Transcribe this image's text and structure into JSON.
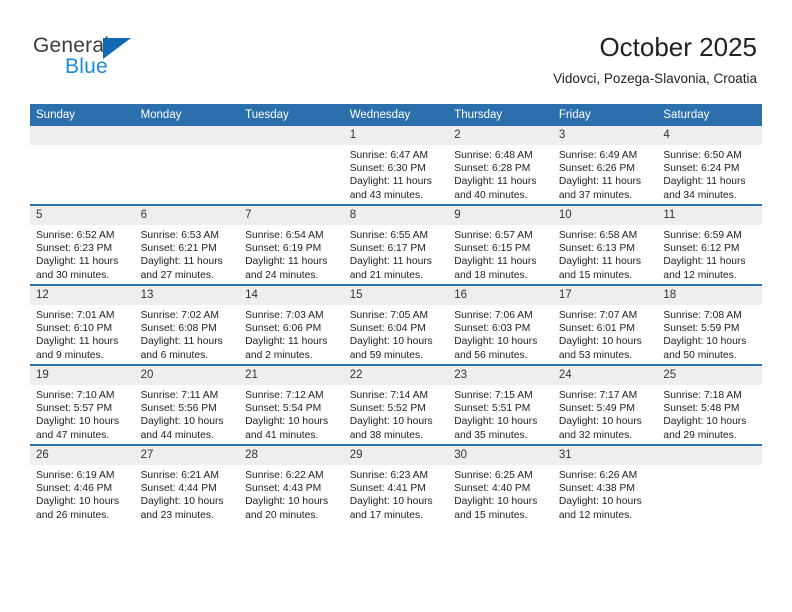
{
  "brand": {
    "name_part1": "General",
    "name_part2": "Blue",
    "accent_color": "#1268b3",
    "blue_text_color": "#1a8cd8"
  },
  "header": {
    "title": "October 2025",
    "subtitle": "Vidovci, Pozega-Slavonia, Croatia"
  },
  "colors": {
    "header_row_bg": "#2c6fad",
    "day_band_bg": "#eeeeee",
    "row_divider": "#2c6fad"
  },
  "weekdays": [
    "Sunday",
    "Monday",
    "Tuesday",
    "Wednesday",
    "Thursday",
    "Friday",
    "Saturday"
  ],
  "weeks": [
    [
      {
        "day": "",
        "sunrise": "",
        "sunset": "",
        "daylight_line1": "",
        "daylight_line2": ""
      },
      {
        "day": "",
        "sunrise": "",
        "sunset": "",
        "daylight_line1": "",
        "daylight_line2": ""
      },
      {
        "day": "",
        "sunrise": "",
        "sunset": "",
        "daylight_line1": "",
        "daylight_line2": ""
      },
      {
        "day": "1",
        "sunrise": "Sunrise: 6:47 AM",
        "sunset": "Sunset: 6:30 PM",
        "daylight_line1": "Daylight: 11 hours",
        "daylight_line2": "and 43 minutes."
      },
      {
        "day": "2",
        "sunrise": "Sunrise: 6:48 AM",
        "sunset": "Sunset: 6:28 PM",
        "daylight_line1": "Daylight: 11 hours",
        "daylight_line2": "and 40 minutes."
      },
      {
        "day": "3",
        "sunrise": "Sunrise: 6:49 AM",
        "sunset": "Sunset: 6:26 PM",
        "daylight_line1": "Daylight: 11 hours",
        "daylight_line2": "and 37 minutes."
      },
      {
        "day": "4",
        "sunrise": "Sunrise: 6:50 AM",
        "sunset": "Sunset: 6:24 PM",
        "daylight_line1": "Daylight: 11 hours",
        "daylight_line2": "and 34 minutes."
      }
    ],
    [
      {
        "day": "5",
        "sunrise": "Sunrise: 6:52 AM",
        "sunset": "Sunset: 6:23 PM",
        "daylight_line1": "Daylight: 11 hours",
        "daylight_line2": "and 30 minutes."
      },
      {
        "day": "6",
        "sunrise": "Sunrise: 6:53 AM",
        "sunset": "Sunset: 6:21 PM",
        "daylight_line1": "Daylight: 11 hours",
        "daylight_line2": "and 27 minutes."
      },
      {
        "day": "7",
        "sunrise": "Sunrise: 6:54 AM",
        "sunset": "Sunset: 6:19 PM",
        "daylight_line1": "Daylight: 11 hours",
        "daylight_line2": "and 24 minutes."
      },
      {
        "day": "8",
        "sunrise": "Sunrise: 6:55 AM",
        "sunset": "Sunset: 6:17 PM",
        "daylight_line1": "Daylight: 11 hours",
        "daylight_line2": "and 21 minutes."
      },
      {
        "day": "9",
        "sunrise": "Sunrise: 6:57 AM",
        "sunset": "Sunset: 6:15 PM",
        "daylight_line1": "Daylight: 11 hours",
        "daylight_line2": "and 18 minutes."
      },
      {
        "day": "10",
        "sunrise": "Sunrise: 6:58 AM",
        "sunset": "Sunset: 6:13 PM",
        "daylight_line1": "Daylight: 11 hours",
        "daylight_line2": "and 15 minutes."
      },
      {
        "day": "11",
        "sunrise": "Sunrise: 6:59 AM",
        "sunset": "Sunset: 6:12 PM",
        "daylight_line1": "Daylight: 11 hours",
        "daylight_line2": "and 12 minutes."
      }
    ],
    [
      {
        "day": "12",
        "sunrise": "Sunrise: 7:01 AM",
        "sunset": "Sunset: 6:10 PM",
        "daylight_line1": "Daylight: 11 hours",
        "daylight_line2": "and 9 minutes."
      },
      {
        "day": "13",
        "sunrise": "Sunrise: 7:02 AM",
        "sunset": "Sunset: 6:08 PM",
        "daylight_line1": "Daylight: 11 hours",
        "daylight_line2": "and 6 minutes."
      },
      {
        "day": "14",
        "sunrise": "Sunrise: 7:03 AM",
        "sunset": "Sunset: 6:06 PM",
        "daylight_line1": "Daylight: 11 hours",
        "daylight_line2": "and 2 minutes."
      },
      {
        "day": "15",
        "sunrise": "Sunrise: 7:05 AM",
        "sunset": "Sunset: 6:04 PM",
        "daylight_line1": "Daylight: 10 hours",
        "daylight_line2": "and 59 minutes."
      },
      {
        "day": "16",
        "sunrise": "Sunrise: 7:06 AM",
        "sunset": "Sunset: 6:03 PM",
        "daylight_line1": "Daylight: 10 hours",
        "daylight_line2": "and 56 minutes."
      },
      {
        "day": "17",
        "sunrise": "Sunrise: 7:07 AM",
        "sunset": "Sunset: 6:01 PM",
        "daylight_line1": "Daylight: 10 hours",
        "daylight_line2": "and 53 minutes."
      },
      {
        "day": "18",
        "sunrise": "Sunrise: 7:08 AM",
        "sunset": "Sunset: 5:59 PM",
        "daylight_line1": "Daylight: 10 hours",
        "daylight_line2": "and 50 minutes."
      }
    ],
    [
      {
        "day": "19",
        "sunrise": "Sunrise: 7:10 AM",
        "sunset": "Sunset: 5:57 PM",
        "daylight_line1": "Daylight: 10 hours",
        "daylight_line2": "and 47 minutes."
      },
      {
        "day": "20",
        "sunrise": "Sunrise: 7:11 AM",
        "sunset": "Sunset: 5:56 PM",
        "daylight_line1": "Daylight: 10 hours",
        "daylight_line2": "and 44 minutes."
      },
      {
        "day": "21",
        "sunrise": "Sunrise: 7:12 AM",
        "sunset": "Sunset: 5:54 PM",
        "daylight_line1": "Daylight: 10 hours",
        "daylight_line2": "and 41 minutes."
      },
      {
        "day": "22",
        "sunrise": "Sunrise: 7:14 AM",
        "sunset": "Sunset: 5:52 PM",
        "daylight_line1": "Daylight: 10 hours",
        "daylight_line2": "and 38 minutes."
      },
      {
        "day": "23",
        "sunrise": "Sunrise: 7:15 AM",
        "sunset": "Sunset: 5:51 PM",
        "daylight_line1": "Daylight: 10 hours",
        "daylight_line2": "and 35 minutes."
      },
      {
        "day": "24",
        "sunrise": "Sunrise: 7:17 AM",
        "sunset": "Sunset: 5:49 PM",
        "daylight_line1": "Daylight: 10 hours",
        "daylight_line2": "and 32 minutes."
      },
      {
        "day": "25",
        "sunrise": "Sunrise: 7:18 AM",
        "sunset": "Sunset: 5:48 PM",
        "daylight_line1": "Daylight: 10 hours",
        "daylight_line2": "and 29 minutes."
      }
    ],
    [
      {
        "day": "26",
        "sunrise": "Sunrise: 6:19 AM",
        "sunset": "Sunset: 4:46 PM",
        "daylight_line1": "Daylight: 10 hours",
        "daylight_line2": "and 26 minutes."
      },
      {
        "day": "27",
        "sunrise": "Sunrise: 6:21 AM",
        "sunset": "Sunset: 4:44 PM",
        "daylight_line1": "Daylight: 10 hours",
        "daylight_line2": "and 23 minutes."
      },
      {
        "day": "28",
        "sunrise": "Sunrise: 6:22 AM",
        "sunset": "Sunset: 4:43 PM",
        "daylight_line1": "Daylight: 10 hours",
        "daylight_line2": "and 20 minutes."
      },
      {
        "day": "29",
        "sunrise": "Sunrise: 6:23 AM",
        "sunset": "Sunset: 4:41 PM",
        "daylight_line1": "Daylight: 10 hours",
        "daylight_line2": "and 17 minutes."
      },
      {
        "day": "30",
        "sunrise": "Sunrise: 6:25 AM",
        "sunset": "Sunset: 4:40 PM",
        "daylight_line1": "Daylight: 10 hours",
        "daylight_line2": "and 15 minutes."
      },
      {
        "day": "31",
        "sunrise": "Sunrise: 6:26 AM",
        "sunset": "Sunset: 4:38 PM",
        "daylight_line1": "Daylight: 10 hours",
        "daylight_line2": "and 12 minutes."
      },
      {
        "day": "",
        "sunrise": "",
        "sunset": "",
        "daylight_line1": "",
        "daylight_line2": ""
      }
    ]
  ]
}
